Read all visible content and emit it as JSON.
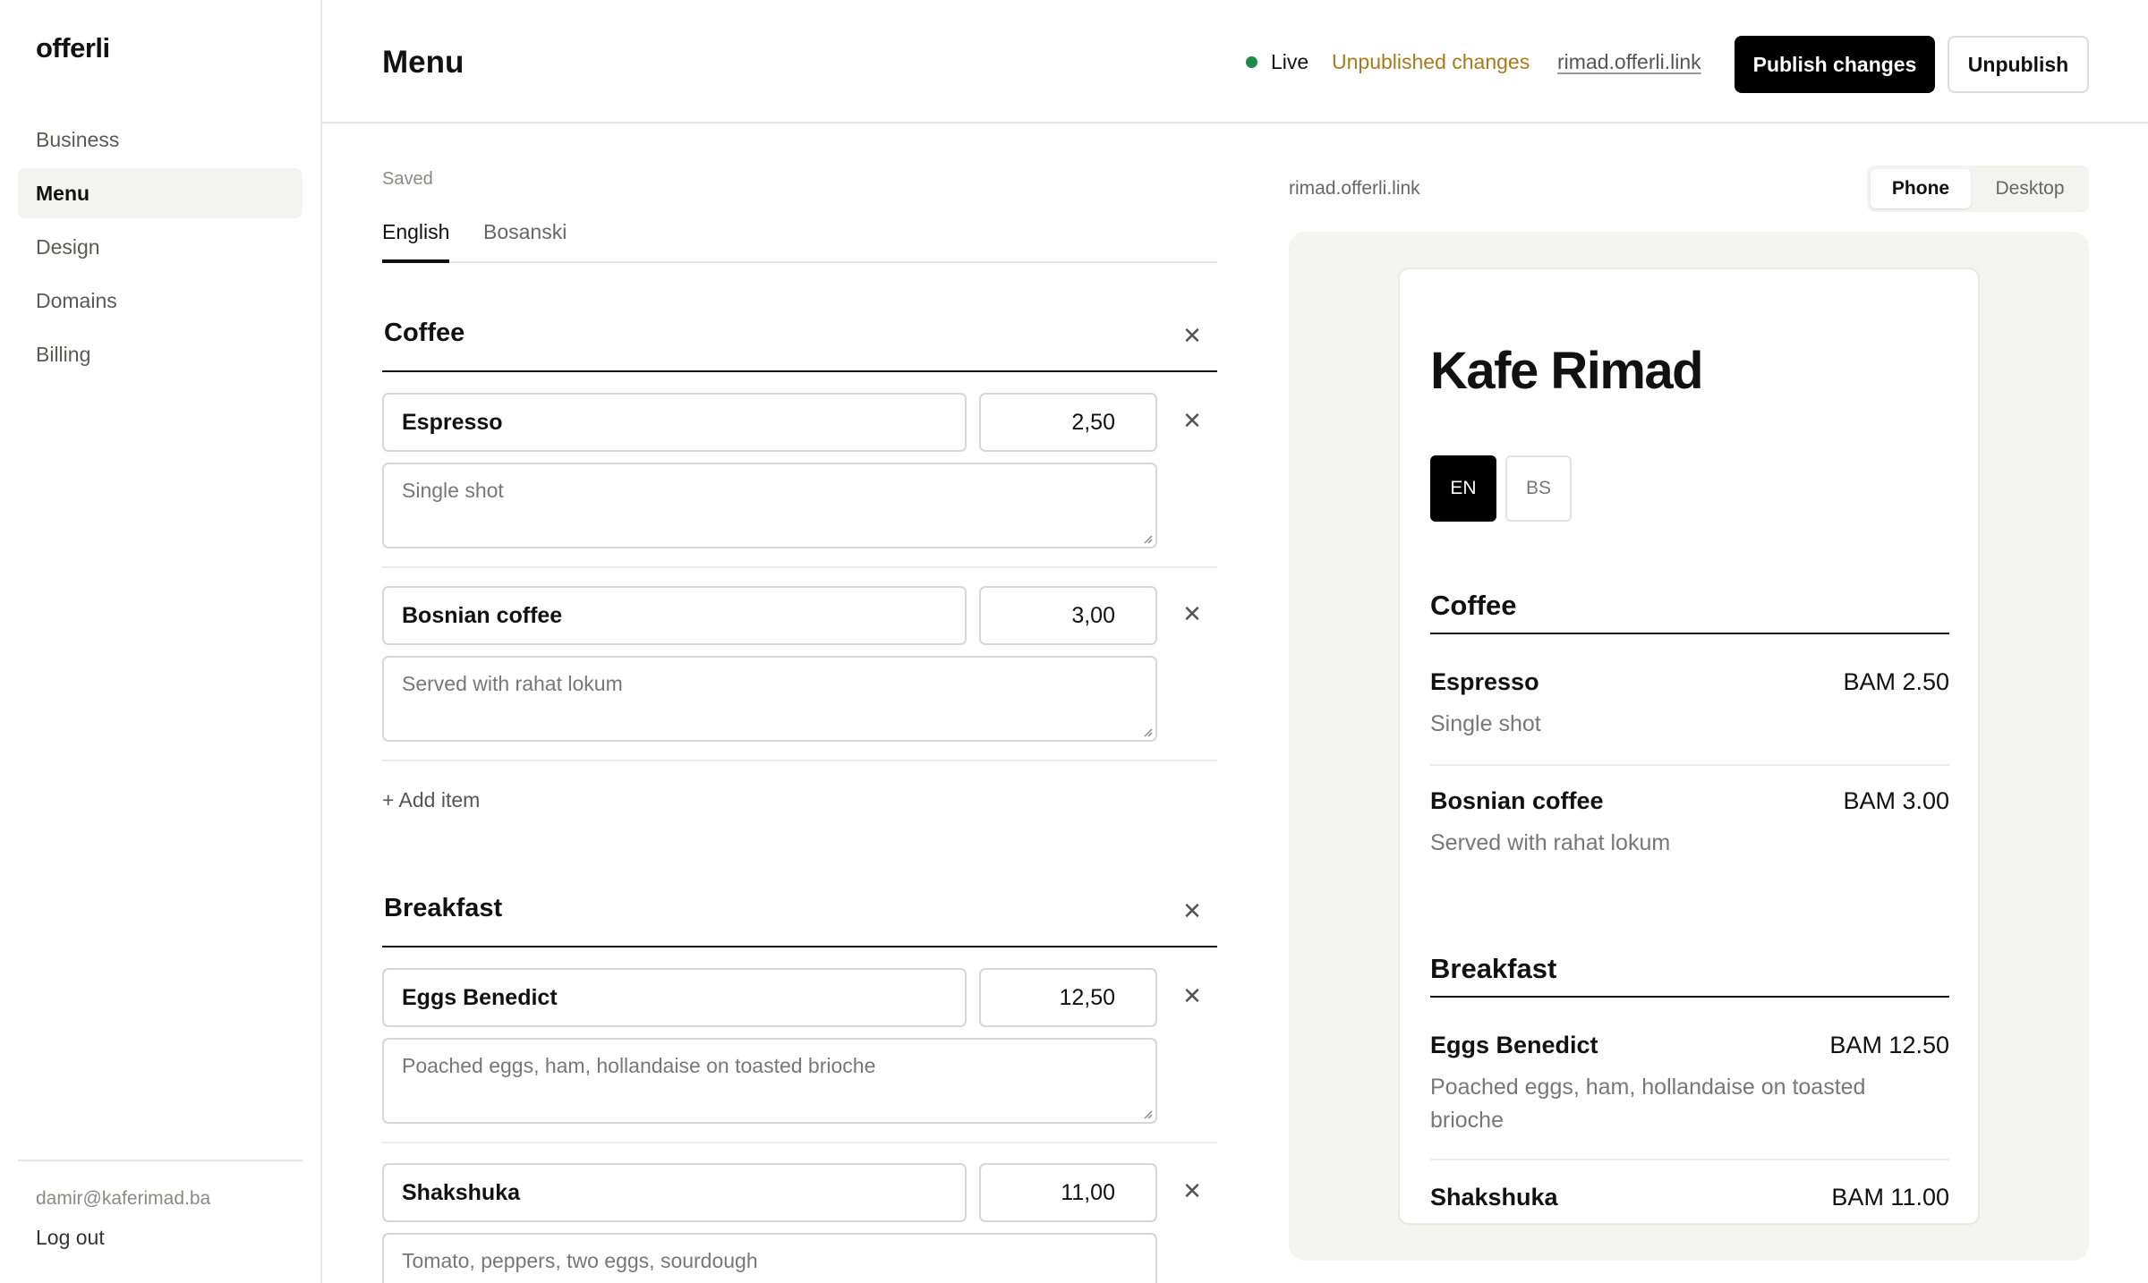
{
  "app": {
    "logo": "offerli"
  },
  "sidebar": {
    "items": [
      {
        "label": "Business"
      },
      {
        "label": "Menu"
      },
      {
        "label": "Design"
      },
      {
        "label": "Domains"
      },
      {
        "label": "Billing"
      }
    ],
    "active": "Menu",
    "user_email": "damir@kaferimad.ba",
    "logout_label": "Log out"
  },
  "header": {
    "title": "Menu",
    "status_label": "Live",
    "status_color": "#1f8a4c",
    "unpublished_label": "Unpublished changes",
    "unpublished_color": "#a87a1a",
    "site_link": "rimad.offerli.link",
    "publish_label": "Publish changes",
    "unpublish_label": "Unpublish"
  },
  "editor": {
    "save_status": "Saved",
    "tabs": [
      {
        "label": "English"
      },
      {
        "label": "Bosanski"
      }
    ],
    "active_tab": "English",
    "add_item_label": "+ Add item",
    "sections": [
      {
        "name": "Coffee",
        "items": [
          {
            "name": "Espresso",
            "price": "2,50",
            "description": "Single shot"
          },
          {
            "name": "Bosnian coffee",
            "price": "3,00",
            "description": "Served with rahat lokum"
          }
        ]
      },
      {
        "name": "Breakfast",
        "items": [
          {
            "name": "Eggs Benedict",
            "price": "12,50",
            "description": "Poached eggs, ham, hollandaise on toasted brioche"
          },
          {
            "name": "Shakshuka",
            "price": "11,00",
            "description": "Tomato, peppers, two eggs, sourdough"
          }
        ]
      }
    ]
  },
  "preview": {
    "url": "rimad.offerli.link",
    "device_options": [
      {
        "label": "Phone"
      },
      {
        "label": "Desktop"
      }
    ],
    "active_device": "Phone",
    "business_name": "Kafe Rimad",
    "languages": [
      {
        "label": "EN"
      },
      {
        "label": "BS"
      }
    ],
    "active_language": "EN",
    "sections": [
      {
        "name": "Coffee",
        "items": [
          {
            "name": "Espresso",
            "price": "BAM 2.50",
            "description": "Single shot"
          },
          {
            "name": "Bosnian coffee",
            "price": "BAM 3.00",
            "description": "Served with rahat lokum"
          }
        ]
      },
      {
        "name": "Breakfast",
        "items": [
          {
            "name": "Eggs Benedict",
            "price": "BAM 12.50",
            "description": "Poached eggs, ham, hollandaise on toasted brioche"
          },
          {
            "name": "Shakshuka",
            "price": "BAM 11.00",
            "description": ""
          }
        ]
      }
    ]
  },
  "icons": {
    "remove": "close-icon",
    "status": "status-dot-icon",
    "resize": "resize-grip-icon"
  }
}
